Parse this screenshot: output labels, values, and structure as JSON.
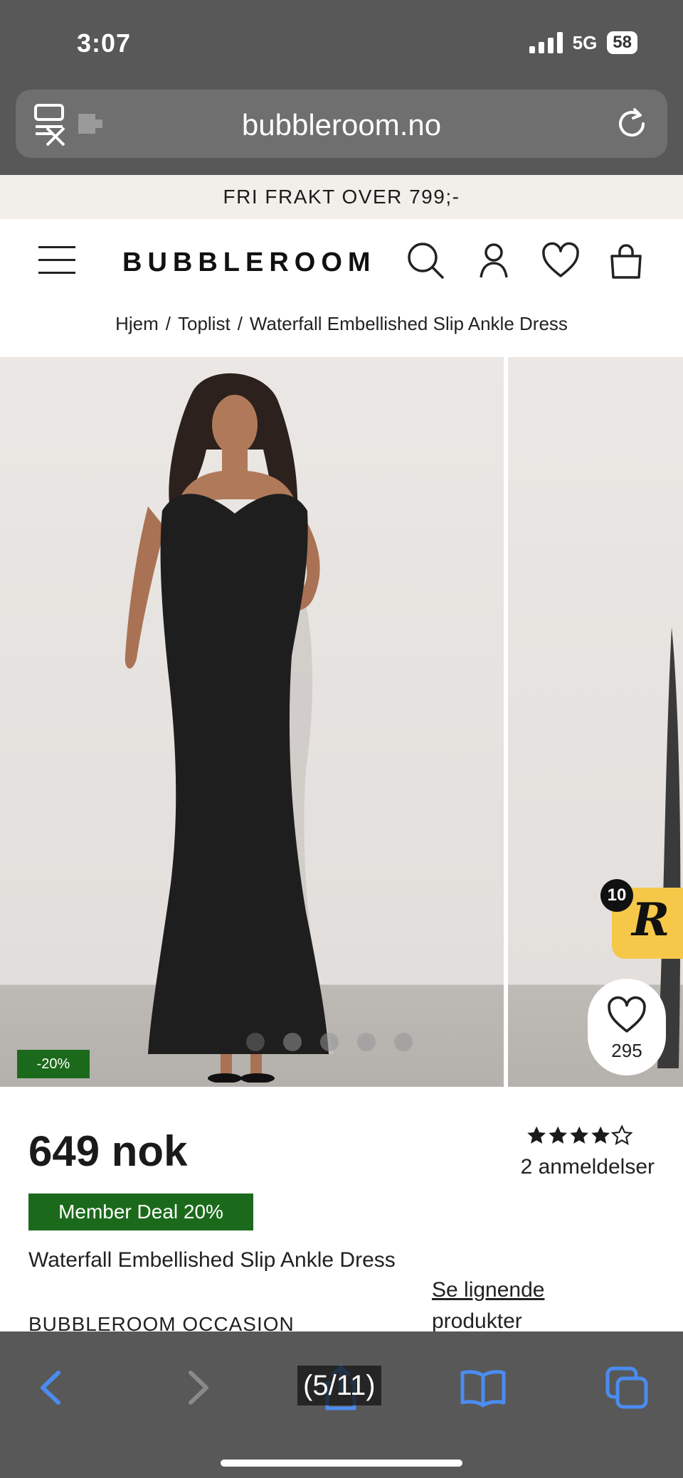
{
  "status_bar": {
    "time": "3:07",
    "network": "5G",
    "battery": "58"
  },
  "browser": {
    "url": "bubbleroom.no",
    "icons": [
      "tab-blocker-icon",
      "reload-icon"
    ]
  },
  "promo_banner": "FRI FRAKT OVER 799;-",
  "header": {
    "brand": "BUBBLEROOM",
    "icons": [
      "menu-icon",
      "search-icon",
      "account-icon",
      "heart-icon",
      "bag-icon"
    ]
  },
  "breadcrumb": {
    "items": [
      "Hjem",
      "Toplist",
      "Waterfall Embellished Slip Ankle Dress"
    ],
    "separator": "/"
  },
  "gallery": {
    "discount_badge": "-20%",
    "favorite_count": "295",
    "loyalty_badge": {
      "count": "10",
      "letter": "R"
    },
    "dots_total": 5,
    "active_dot": 1
  },
  "product": {
    "price": "649 nok",
    "rating": 4.5,
    "rating_max": 5,
    "reviews": "2 anmeldelser",
    "member_deal": "Member Deal 20%",
    "name": "Waterfall Embellished Slip Ankle Dress",
    "brand": "BUBBLEROOM OCCASION",
    "similar_line1": "Se lignende",
    "similar_line2": "produkter"
  },
  "toolbar": {
    "page_counter": "(5/11)",
    "icons": [
      "back-icon",
      "forward-icon",
      "share-icon",
      "bookmarks-icon",
      "tabs-icon"
    ]
  },
  "colors": {
    "chrome": "#585858",
    "promo_bg": "#f2efea",
    "deal_green": "#1b6a1b",
    "badge_yellow": "#f6c84a",
    "link_blue": "#3b82f6"
  }
}
